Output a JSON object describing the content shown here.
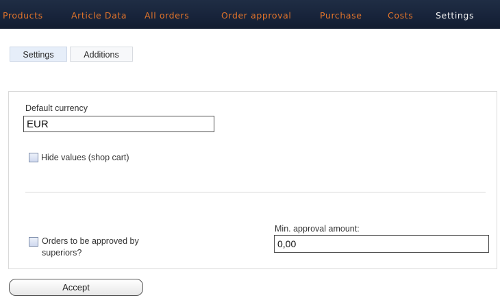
{
  "nav": {
    "items": [
      {
        "label": "Products"
      },
      {
        "label": "Article Data"
      },
      {
        "label": "All orders"
      },
      {
        "label": "Order approval"
      },
      {
        "label": "Purchase"
      },
      {
        "label": "Costs"
      },
      {
        "label": "Settings"
      }
    ],
    "active": "Settings"
  },
  "tabs": [
    {
      "label": "Settings",
      "selected": true
    },
    {
      "label": "Additions",
      "selected": false
    }
  ],
  "settings": {
    "currency_label": "Default currency",
    "currency_value": "EUR",
    "hide_values_label": "Hide values (shop cart)",
    "hide_values_checked": false,
    "orders_approval_label_line1": "Orders to be approved by",
    "orders_approval_label_line2": "superiors?",
    "orders_approval_checked": false,
    "min_amount_label": "Min. approval amount:",
    "min_amount_value": "0,00"
  },
  "actions": {
    "accept_label": "Accept"
  },
  "colors": {
    "nav_bg": "#17233a",
    "nav_link": "#e2742a",
    "nav_active": "#f2f2f2"
  }
}
